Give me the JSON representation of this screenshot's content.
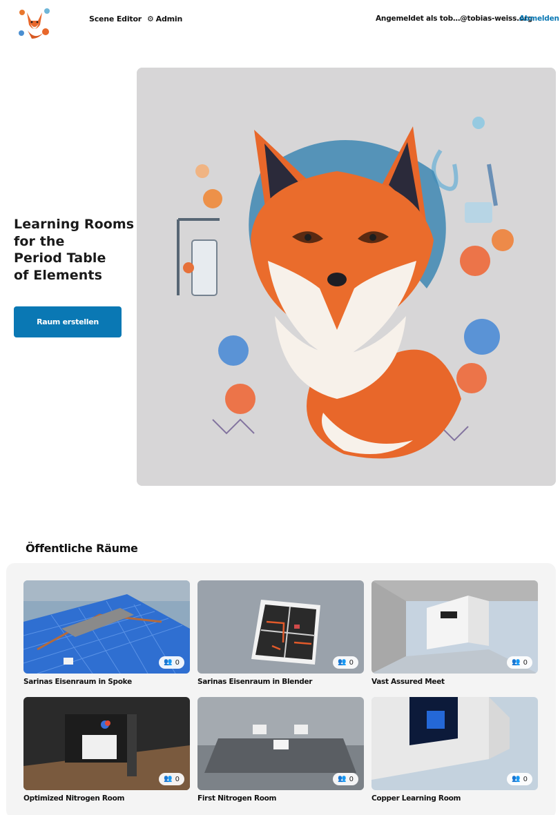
{
  "header": {
    "logo_icon": "fox-chemist-logo",
    "nav": {
      "scene_editor": "Scene Editor",
      "admin": "Admin",
      "admin_icon": "gear-icon"
    },
    "signed_in_text": "Angemeldet als tob…@tobias-weiss.org",
    "signout_label": "Abmelden"
  },
  "hero": {
    "title_lines": [
      "Learning Rooms",
      "for the",
      "Period Table",
      "of Elements"
    ],
    "create_button": "Raum erstellen",
    "image_icon": "fox-chemistry-illustration"
  },
  "public_rooms": {
    "title": "Öffentliche Räume",
    "rooms": [
      {
        "name": "Sarinas Eisenraum in Spoke",
        "count": "0"
      },
      {
        "name": "Sarinas Eisenraum in Blender",
        "count": "0"
      },
      {
        "name": "Vast Assured Meet",
        "count": "0"
      },
      {
        "name": "Optimized Nitrogen Room",
        "count": "0"
      },
      {
        "name": "First Nitrogen Room",
        "count": "0"
      },
      {
        "name": "Copper Learning Room",
        "count": "0"
      }
    ]
  },
  "colors": {
    "accent": "#0a78b4",
    "panel": "#f4f4f4",
    "hero_bg": "#d7d6d7",
    "fox_orange": "#e8672a"
  }
}
